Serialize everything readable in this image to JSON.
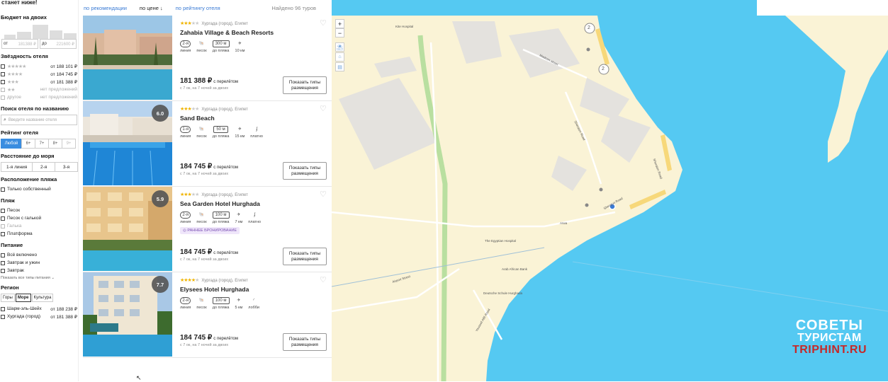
{
  "banner": "станет ниже!",
  "budget": {
    "title": "Бюджет на двоих",
    "from_label": "от",
    "from_value": "181388 ₽",
    "to_label": "до",
    "to_value": "221600 ₽"
  },
  "stars_filter": {
    "title": "Звёздность отеля",
    "rows": [
      {
        "stars": "★★★★★",
        "value": "от 188 101 ₽",
        "dim": false
      },
      {
        "stars": "★★★★",
        "value": "от 184 745 ₽",
        "dim": false
      },
      {
        "stars": "★★★",
        "value": "от 181 388 ₽",
        "dim": false
      },
      {
        "stars": "★★",
        "value": "нет предложений",
        "dim": true
      },
      {
        "stars": "другое",
        "value": "нет предложений",
        "dim": true
      }
    ]
  },
  "hotel_search": {
    "title": "Поиск отеля по названию",
    "placeholder": "Введите название отеля"
  },
  "hotel_rating": {
    "title": "Рейтинг отеля",
    "options": [
      "Любой",
      "6+",
      "7+",
      "8+",
      "9+"
    ]
  },
  "sea_distance": {
    "title": "Расстояние до моря",
    "options": [
      "1-я линия",
      "2-я",
      "3-я"
    ]
  },
  "beach_location": {
    "title": "Расположение пляжа",
    "option": "Только собственный"
  },
  "beach": {
    "title": "Пляж",
    "options": [
      {
        "label": "Песок",
        "dim": false
      },
      {
        "label": "Песок с галькой",
        "dim": false
      },
      {
        "label": "Галька",
        "dim": true
      },
      {
        "label": "Платформа",
        "dim": false
      }
    ]
  },
  "meals": {
    "title": "Питание",
    "options": [
      "Всё включено",
      "Завтрак и ужин",
      "Завтрак"
    ],
    "more": "Показать все типы питания"
  },
  "region": {
    "title": "Регион",
    "tags": [
      "Горы",
      "Море",
      "Культура"
    ],
    "rows": [
      {
        "label": "Шарм-эль-Шейх",
        "value": "от 188 238 ₽"
      },
      {
        "label": "Хургада (город)",
        "value": "от 181 388 ₽"
      }
    ]
  },
  "sort": {
    "tabs": [
      "по рекомендации",
      "по цене",
      "по рейтингу отеля"
    ],
    "active": 1,
    "found": "Найдено 96 туров"
  },
  "hotels": [
    {
      "name": "Zahabia Village & Beach Resorts",
      "stars_on": "★★★",
      "stars_off": "★★",
      "location": "Хургада (город), Египет",
      "rating": "",
      "features": [
        {
          "value": "2-я",
          "label": "линия",
          "kind": "pill"
        },
        {
          "value": "🐚",
          "label": "песок",
          "kind": "icon"
        },
        {
          "value": "300 м",
          "label": "до пляжа",
          "kind": "rect"
        },
        {
          "value": "✈",
          "label": "10 км",
          "kind": "icon"
        }
      ],
      "promo": "",
      "price": "181 388 ₽",
      "price_caption": "с перелётом",
      "price_sub": "с 7 ок, на 7 ночей за двоих",
      "button": [
        "Показать типы",
        "размещения"
      ]
    },
    {
      "name": "Sand Beach",
      "stars_on": "★★★",
      "stars_off": "★★",
      "location": "Хургада (город), Египет",
      "rating": "6.0",
      "features": [
        {
          "value": "1-я",
          "label": "линия",
          "kind": "pill"
        },
        {
          "value": "🐚",
          "label": "песок",
          "kind": "icon"
        },
        {
          "value": "50 м",
          "label": "до пляжа",
          "kind": "rect"
        },
        {
          "value": "✈",
          "label": "15 км",
          "kind": "icon"
        },
        {
          "value": "ʄ",
          "label": "платно",
          "kind": "icon"
        }
      ],
      "promo": "",
      "price": "184 745 ₽",
      "price_caption": "с перелётом",
      "price_sub": "с 7 ок, на 7 ночей за двоих",
      "button": [
        "Показать типы",
        "размещения"
      ]
    },
    {
      "name": "Sea Garden Hotel Hurghada",
      "stars_on": "★★★",
      "stars_off": "★★",
      "location": "Хургада (город), Египет",
      "rating": "5.9",
      "features": [
        {
          "value": "2-я",
          "label": "линия",
          "kind": "pill"
        },
        {
          "value": "🐚",
          "label": "песок",
          "kind": "icon"
        },
        {
          "value": "100 м",
          "label": "до пляжа",
          "kind": "rect"
        },
        {
          "value": "✈",
          "label": "7 км",
          "kind": "icon"
        },
        {
          "value": "ʄ",
          "label": "платно",
          "kind": "icon"
        }
      ],
      "promo": "◎ РАННЕЕ БРОНИРОВАНИЕ",
      "price": "184 745 ₽",
      "price_caption": "с перелётом",
      "price_sub": "с 7 ок, на 7 ночей за двоих",
      "button": [
        "Показать типы",
        "размещения"
      ]
    },
    {
      "name": "Elysees Hotel Hurghada",
      "stars_on": "★★★★",
      "stars_off": "★",
      "location": "Хургада (город), Египет",
      "rating": "7.7",
      "features": [
        {
          "value": "2-я",
          "label": "линия",
          "kind": "pill"
        },
        {
          "value": "🐚",
          "label": "песок",
          "kind": "icon"
        },
        {
          "value": "100 м",
          "label": "до пляжа",
          "kind": "rect"
        },
        {
          "value": "✈",
          "label": "5 км",
          "kind": "icon"
        },
        {
          "value": "◜",
          "label": "лобби",
          "kind": "icon"
        }
      ],
      "promo": "",
      "price": "184 745 ₽",
      "price_caption": "с перелётом",
      "price_sub": "с 7 ок, на 7 ночей за двоих",
      "button": [
        "Показать типы",
        "размещения"
      ]
    }
  ],
  "map": {
    "zoom_in": "+",
    "zoom_out": "−",
    "labels": [
      "Kite Hospital",
      "Madrom street",
      "Sheraton Road",
      "Sheraton Road",
      "Sheraton Road",
      "Airport Street",
      "The Egyptian Hospital",
      "Arab African Bank",
      "Deutsche Schule Hurghada",
      "Youssef Afifi Road",
      "Arwa"
    ],
    "cluster_markers": [
      "2",
      "2"
    ],
    "colors": {
      "sea": "#55c9f2",
      "land": "#faf3d6",
      "green": "#b9dfa0"
    }
  },
  "watermark": {
    "line1": "СОВЕТЫ",
    "line2": "ТУРИСТАМ",
    "line3": "TRIPHINT.RU"
  }
}
